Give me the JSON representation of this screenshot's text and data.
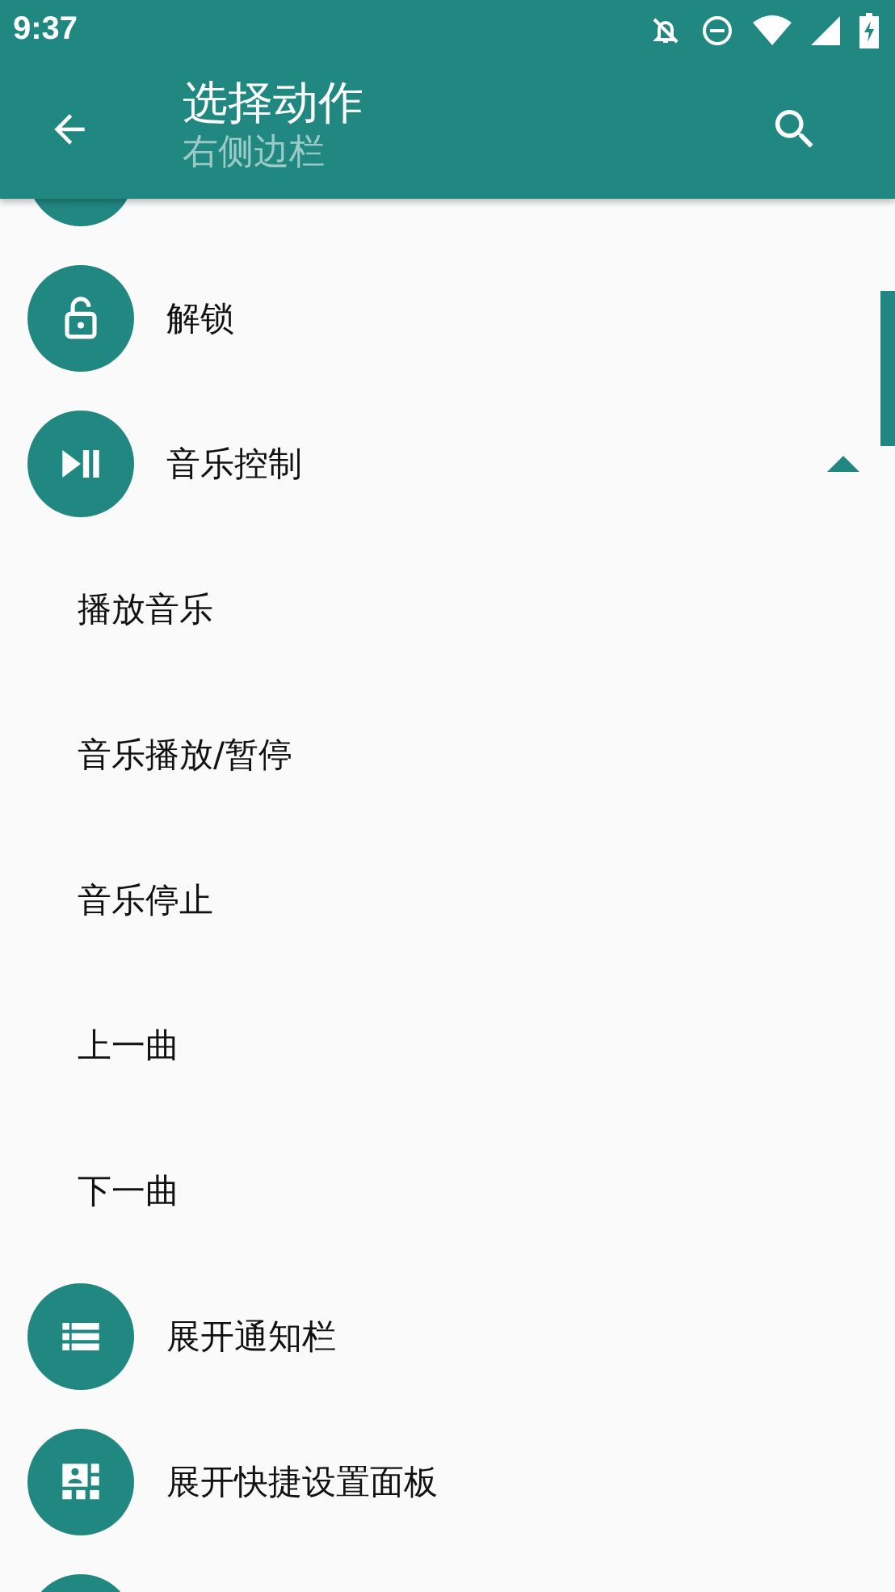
{
  "status_bar": {
    "time": "9:37"
  },
  "toolbar": {
    "title": "选择动作",
    "subtitle": "右侧边栏"
  },
  "items": [
    {
      "kind": "partial"
    },
    {
      "kind": "action",
      "label": "解锁"
    },
    {
      "kind": "group",
      "label": "音乐控制",
      "expanded": true,
      "children": [
        {
          "label": "播放音乐"
        },
        {
          "label": "音乐播放/暂停"
        },
        {
          "label": "音乐停止"
        },
        {
          "label": "上一曲"
        },
        {
          "label": "下一曲"
        }
      ]
    },
    {
      "kind": "action",
      "label": "展开通知栏"
    },
    {
      "kind": "action",
      "label": "展开快捷设置面板"
    },
    {
      "kind": "partial"
    }
  ]
}
